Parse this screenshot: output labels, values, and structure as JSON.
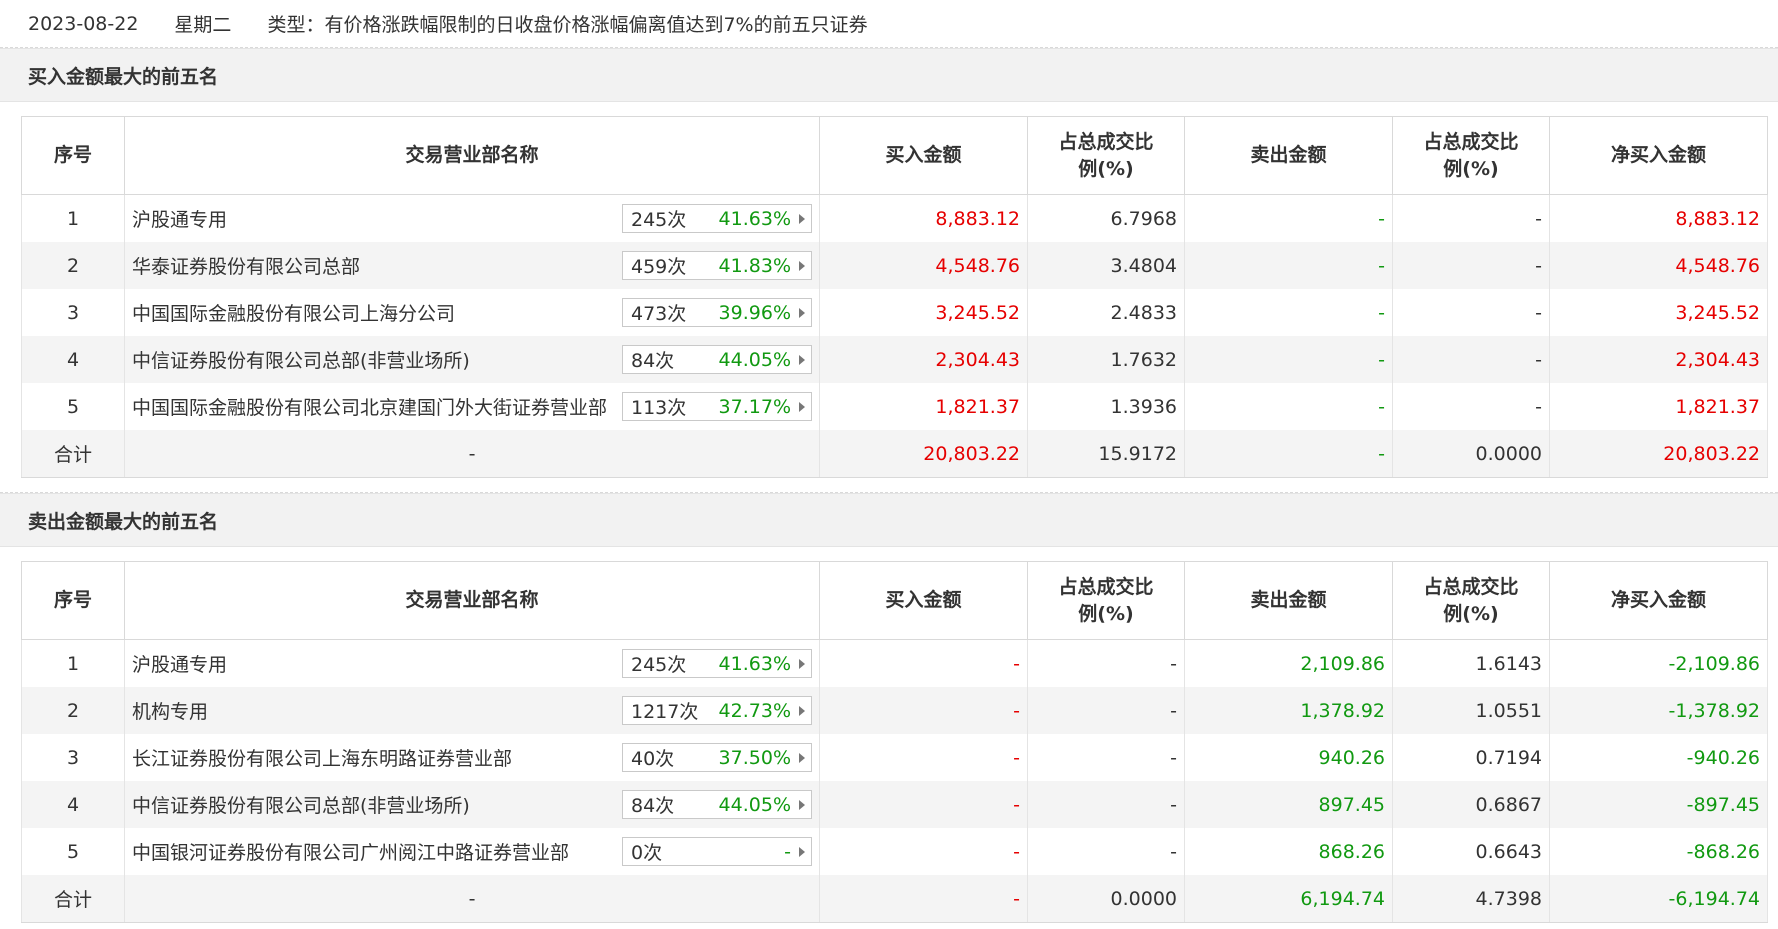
{
  "header": {
    "date": "2023-08-22",
    "weekday": "星期二",
    "type_label": "类型：有价格涨跌幅限制的日收盘价格涨幅偏离值达到7%的前五只证券"
  },
  "columns": {
    "rank": "序号",
    "name": "交易营业部名称",
    "buy": "买入金额",
    "buy_pct": "占总成交比例(%)",
    "sell": "卖出金额",
    "sell_pct": "占总成交比例(%)",
    "net": "净买入金额"
  },
  "buy_section": {
    "title": "买入金额最大的前五名",
    "rows": [
      {
        "rank": "1",
        "name": "沪股通专用",
        "count": "245次",
        "rate": "41.63%",
        "buy": "8,883.12",
        "buy_pct": "6.7968",
        "sell": "-",
        "sell_pct": "-",
        "net": "8,883.12"
      },
      {
        "rank": "2",
        "name": "华泰证券股份有限公司总部",
        "count": "459次",
        "rate": "41.83%",
        "buy": "4,548.76",
        "buy_pct": "3.4804",
        "sell": "-",
        "sell_pct": "-",
        "net": "4,548.76"
      },
      {
        "rank": "3",
        "name": "中国国际金融股份有限公司上海分公司",
        "count": "473次",
        "rate": "39.96%",
        "buy": "3,245.52",
        "buy_pct": "2.4833",
        "sell": "-",
        "sell_pct": "-",
        "net": "3,245.52"
      },
      {
        "rank": "4",
        "name": "中信证券股份有限公司总部(非营业场所)",
        "count": "84次",
        "rate": "44.05%",
        "buy": "2,304.43",
        "buy_pct": "1.7632",
        "sell": "-",
        "sell_pct": "-",
        "net": "2,304.43"
      },
      {
        "rank": "5",
        "name": "中国国际金融股份有限公司北京建国门外大街证券营业部",
        "count": "113次",
        "rate": "37.17%",
        "buy": "1,821.37",
        "buy_pct": "1.3936",
        "sell": "-",
        "sell_pct": "-",
        "net": "1,821.37"
      }
    ],
    "total": {
      "label": "合计",
      "name": "-",
      "buy": "20,803.22",
      "buy_pct": "15.9172",
      "sell": "-",
      "sell_pct": "0.0000",
      "net": "20,803.22"
    }
  },
  "sell_section": {
    "title": "卖出金额最大的前五名",
    "rows": [
      {
        "rank": "1",
        "name": "沪股通专用",
        "count": "245次",
        "rate": "41.63%",
        "buy": "-",
        "buy_pct": "-",
        "sell": "2,109.86",
        "sell_pct": "1.6143",
        "net": "-2,109.86"
      },
      {
        "rank": "2",
        "name": "机构专用",
        "count": "1217次",
        "rate": "42.73%",
        "buy": "-",
        "buy_pct": "-",
        "sell": "1,378.92",
        "sell_pct": "1.0551",
        "net": "-1,378.92"
      },
      {
        "rank": "3",
        "name": "长江证券股份有限公司上海东明路证券营业部",
        "count": "40次",
        "rate": "37.50%",
        "buy": "-",
        "buy_pct": "-",
        "sell": "940.26",
        "sell_pct": "0.7194",
        "net": "-940.26"
      },
      {
        "rank": "4",
        "name": "中信证券股份有限公司总部(非营业场所)",
        "count": "84次",
        "rate": "44.05%",
        "buy": "-",
        "buy_pct": "-",
        "sell": "897.45",
        "sell_pct": "0.6867",
        "net": "-897.45"
      },
      {
        "rank": "5",
        "name": "中国银河证券股份有限公司广州阅江中路证券营业部",
        "count": "0次",
        "rate": "-",
        "buy": "-",
        "buy_pct": "-",
        "sell": "868.26",
        "sell_pct": "0.6643",
        "net": "-868.26"
      }
    ],
    "total": {
      "label": "合计",
      "name": "-",
      "buy": "-",
      "buy_pct": "0.0000",
      "sell": "6,194.74",
      "sell_pct": "4.7398",
      "net": "-6,194.74"
    }
  },
  "colors": {
    "positive": "#e60000",
    "negative": "#119911",
    "stripe": "#f4f4f4",
    "section_bg": "#f2f2f2"
  },
  "icons": {
    "badge_arrow": "caret-right-icon"
  }
}
